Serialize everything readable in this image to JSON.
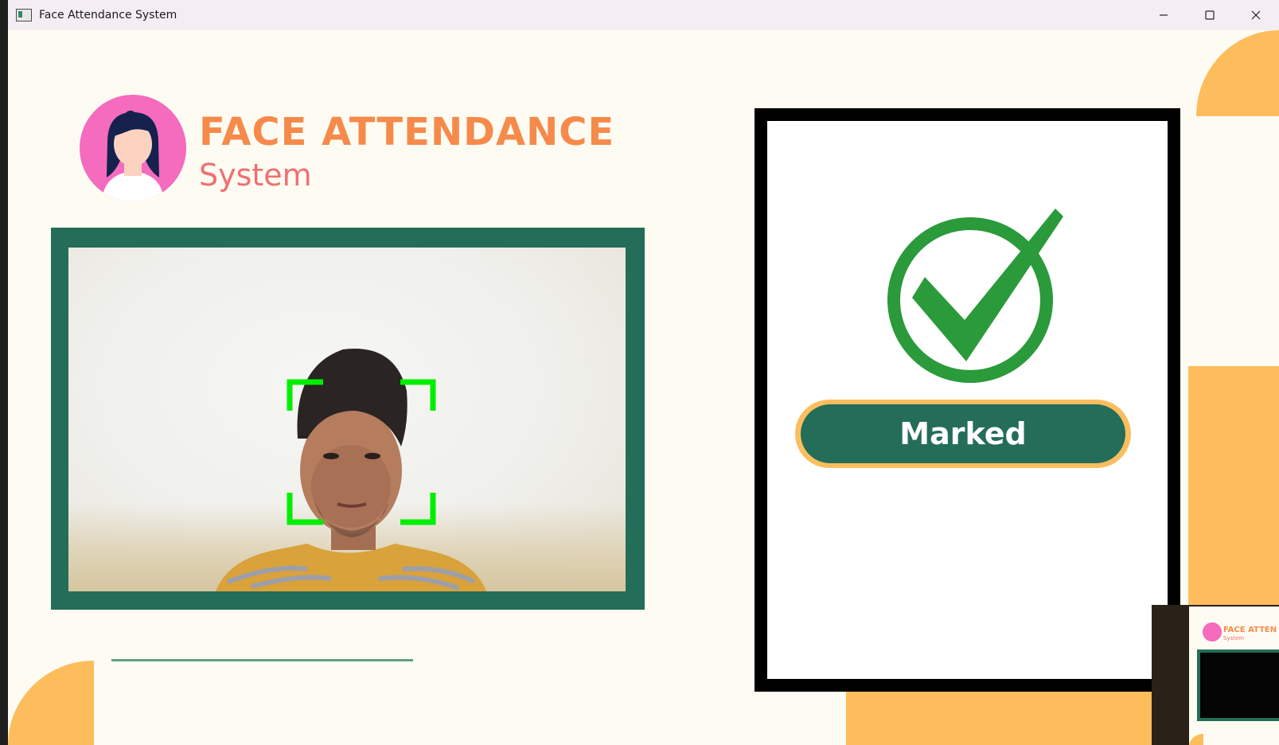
{
  "window": {
    "title": "Face Attendance System",
    "controls": [
      "minimize-icon",
      "maximize-icon",
      "close-icon"
    ]
  },
  "header": {
    "title": "FACE ATTENDANCE",
    "subtitle": "System"
  },
  "status": {
    "label": "Marked",
    "icon": "check-circle-icon"
  },
  "thumbnail": {
    "title": "FACE ATTEN",
    "subtitle": "System"
  },
  "colors": {
    "background": "#fefcf2",
    "frame_green": "#246d58",
    "accent_orange": "#f68a4b",
    "accent_pink": "#ef6f73",
    "deco_yellow": "#fdbd5d",
    "check_green": "#2a9a3a",
    "face_box": "#00ee00"
  }
}
